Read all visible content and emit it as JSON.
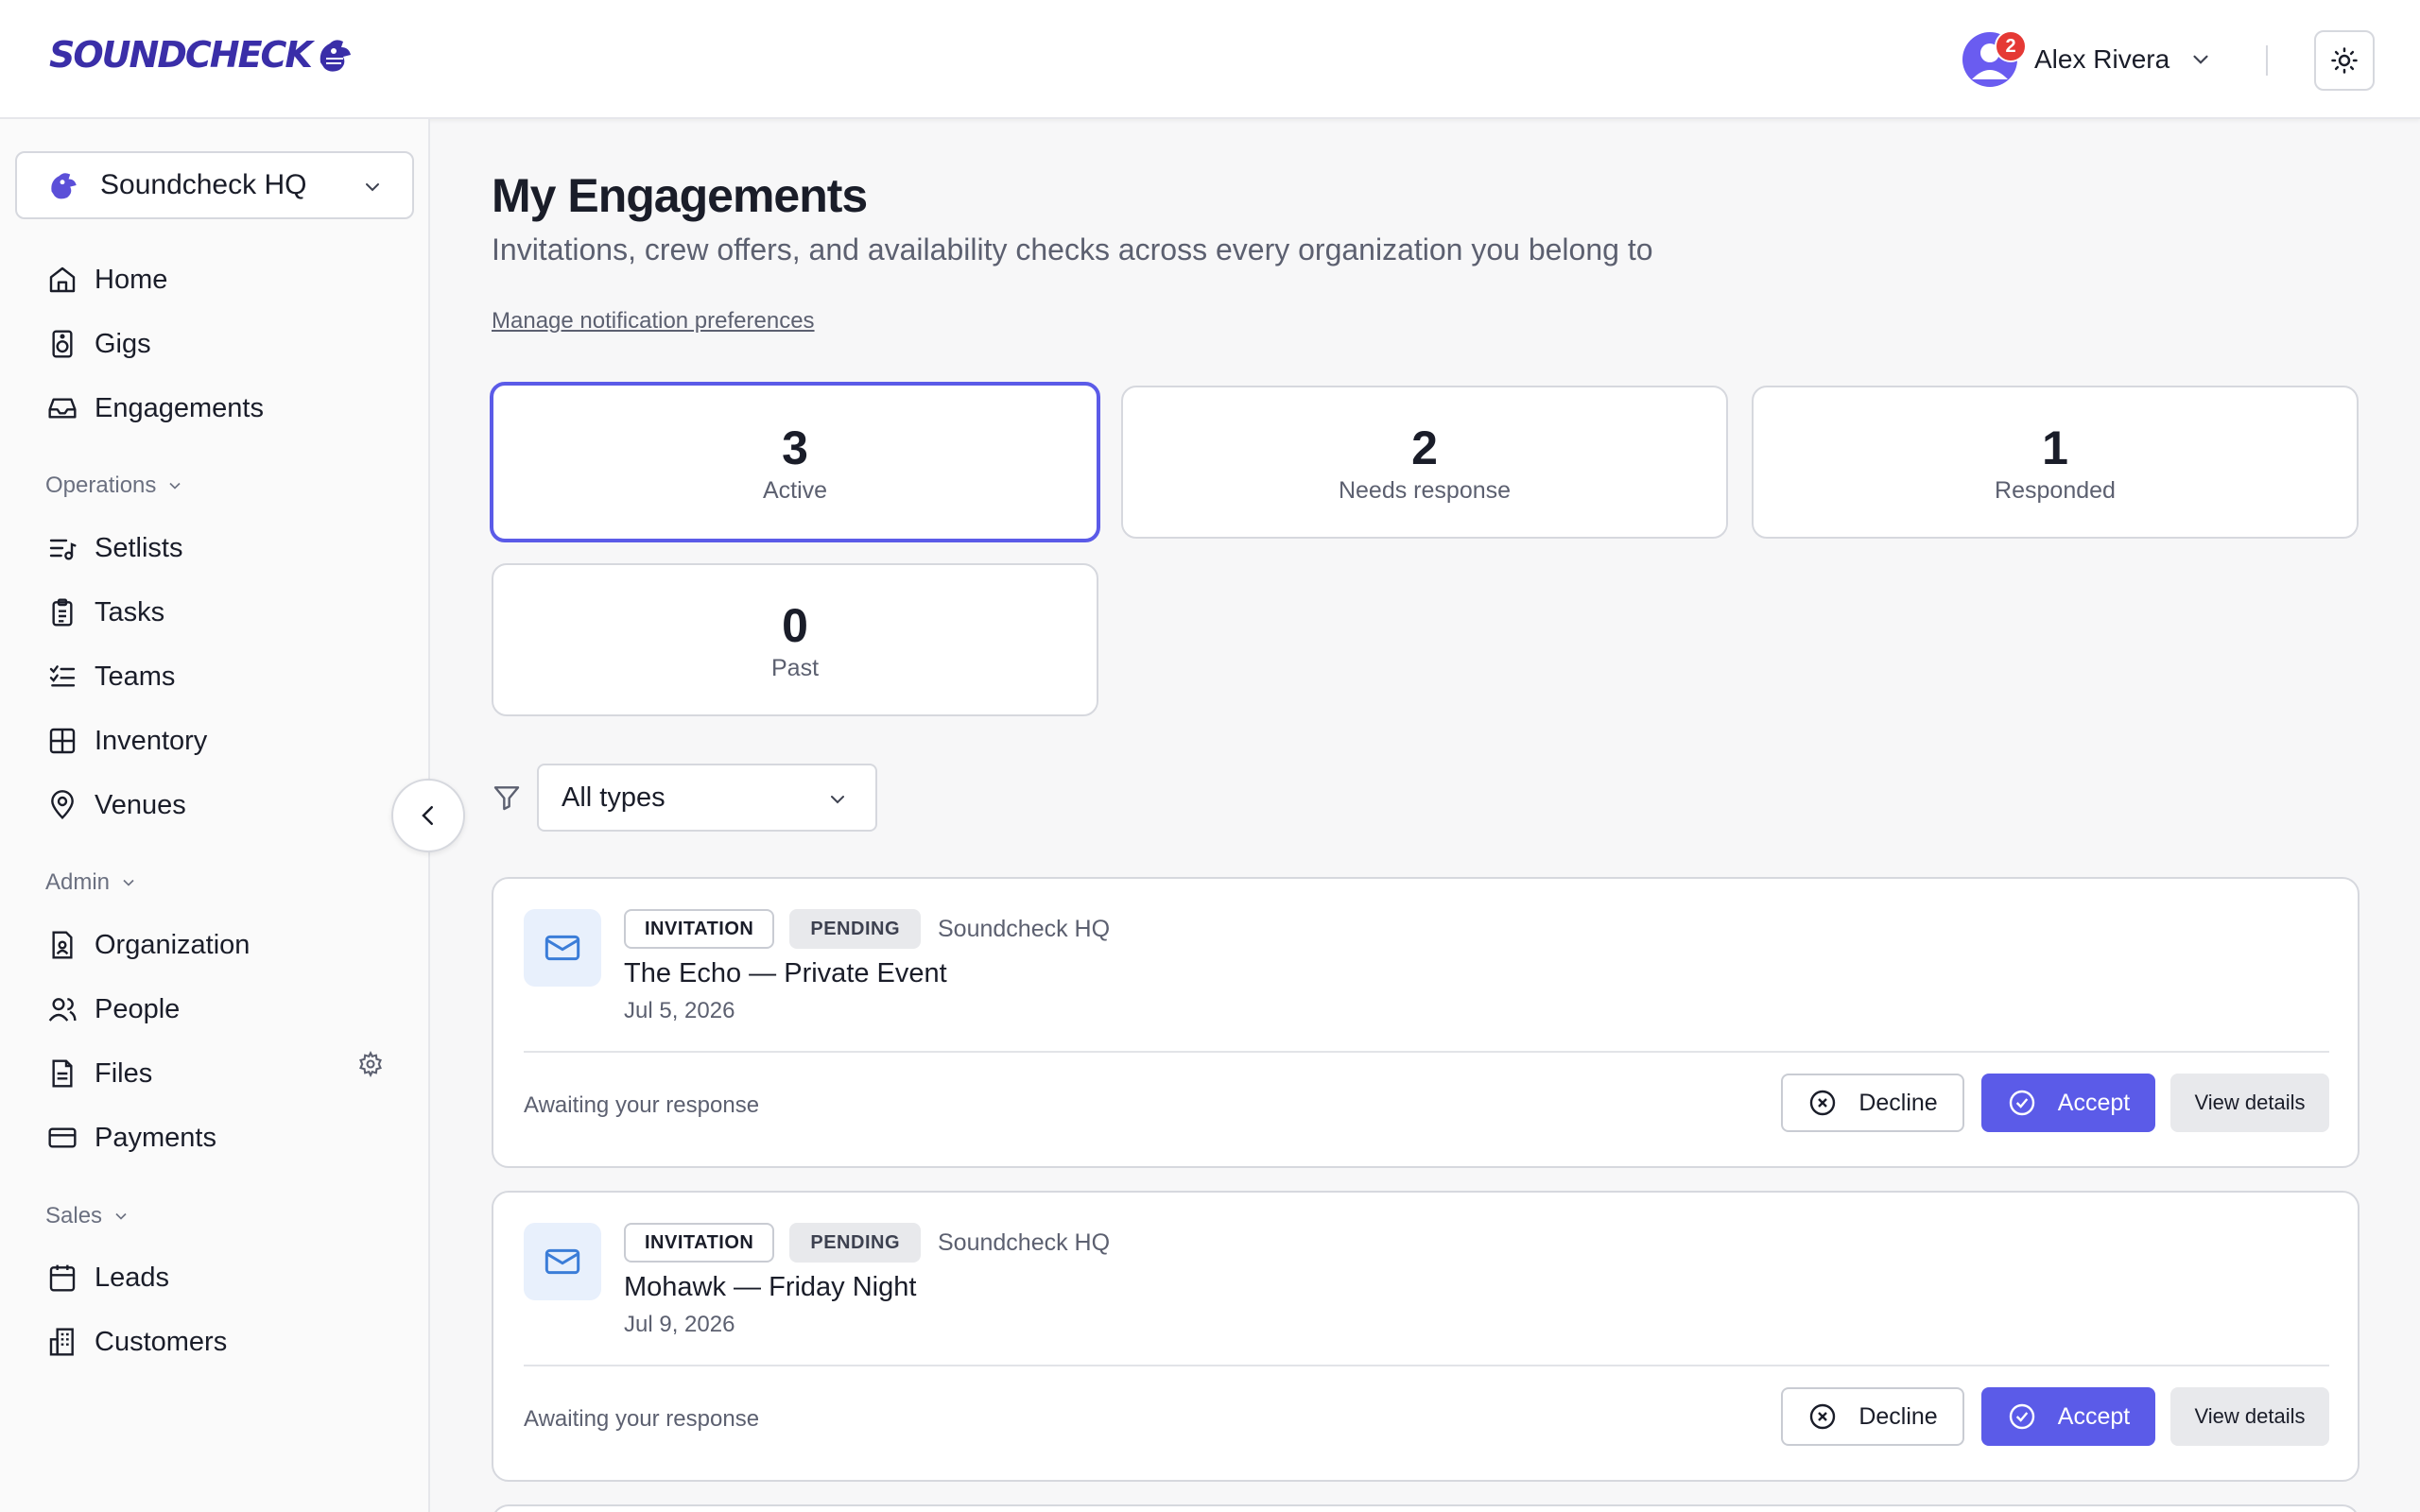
{
  "header": {
    "logo_text": "SOUNDCHECK",
    "user_name": "Alex Rivera",
    "notification_count": "2"
  },
  "sidebar": {
    "org_name": "Soundcheck HQ",
    "items": [
      {
        "label": "Home",
        "icon": "home-icon"
      },
      {
        "label": "Gigs",
        "icon": "speaker-icon"
      },
      {
        "label": "Engagements",
        "icon": "inbox-icon"
      }
    ],
    "sections": [
      {
        "label": "Operations",
        "items": [
          {
            "label": "Setlists",
            "icon": "list-music-icon"
          },
          {
            "label": "Tasks",
            "icon": "clipboard-icon"
          },
          {
            "label": "Teams",
            "icon": "list-checks-icon"
          },
          {
            "label": "Inventory",
            "icon": "grid-icon"
          },
          {
            "label": "Venues",
            "icon": "map-pin-icon"
          }
        ]
      },
      {
        "label": "Admin",
        "items": [
          {
            "label": "Organization",
            "icon": "file-user-icon"
          },
          {
            "label": "People",
            "icon": "users-icon"
          },
          {
            "label": "Files",
            "icon": "file-text-icon"
          },
          {
            "label": "Payments",
            "icon": "credit-card-icon"
          }
        ]
      },
      {
        "label": "Sales",
        "items": [
          {
            "label": "Leads",
            "icon": "calendar-icon"
          },
          {
            "label": "Customers",
            "icon": "building-icon"
          }
        ]
      }
    ]
  },
  "main": {
    "title": "My Engagements",
    "subtitle": "Invitations, crew offers, and availability checks across every organization you belong to",
    "prefs_link": "Manage notification preferences",
    "stats": [
      {
        "value": "3",
        "label": "Active",
        "selected": true
      },
      {
        "value": "2",
        "label": "Needs response",
        "selected": false
      },
      {
        "value": "1",
        "label": "Responded",
        "selected": false
      },
      {
        "value": "0",
        "label": "Past",
        "selected": false
      }
    ],
    "filter": {
      "selected": "All types"
    },
    "engagements": [
      {
        "type_tag": "INVITATION",
        "status_tag": "PENDING",
        "org": "Soundcheck HQ",
        "title": "The Echo — Private Event",
        "date": "Jul 5, 2026",
        "status_text": "Awaiting your response",
        "decline_label": "Decline",
        "accept_label": "Accept",
        "view_label": "View details"
      },
      {
        "type_tag": "INVITATION",
        "status_tag": "PENDING",
        "org": "Soundcheck HQ",
        "title": "Mohawk — Friday Night",
        "date": "Jul 9, 2026",
        "status_text": "Awaiting your response",
        "decline_label": "Decline",
        "accept_label": "Accept",
        "view_label": "View details"
      }
    ]
  },
  "colors": {
    "accent": "#5b5be8",
    "brand": "#3a2ea8",
    "badge": "#e53935"
  }
}
